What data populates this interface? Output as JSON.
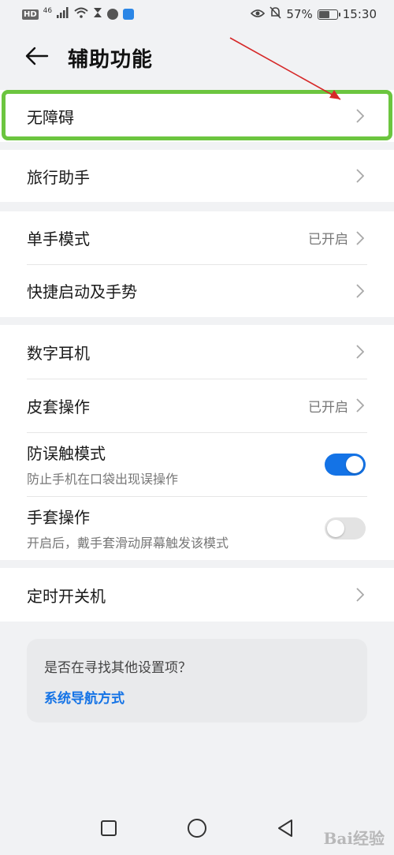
{
  "status_bar": {
    "hd_badge": "HD",
    "network": "46",
    "battery_percent": "57%",
    "time": "15:30",
    "icons": [
      "signal-icon",
      "wifi-icon",
      "hourglass-icon",
      "app-icon",
      "app-icon",
      "eye-icon",
      "bell-off-icon",
      "battery-icon"
    ]
  },
  "header": {
    "title": "辅助功能",
    "back_icon": "arrow-left-icon"
  },
  "groups": [
    {
      "items": [
        {
          "label": "无障碍",
          "value": ""
        }
      ]
    },
    {
      "items": [
        {
          "label": "旅行助手",
          "value": ""
        }
      ]
    },
    {
      "items": [
        {
          "label": "单手模式",
          "value": "已开启"
        },
        {
          "label": "快捷启动及手势",
          "value": ""
        }
      ]
    },
    {
      "items": [
        {
          "label": "数字耳机",
          "value": ""
        },
        {
          "label": "皮套操作",
          "value": "已开启"
        },
        {
          "label": "防误触模式",
          "sub": "防止手机在口袋出现误操作",
          "toggle": true
        },
        {
          "label": "手套操作",
          "sub": "开启后，戴手套滑动屏幕触发该模式",
          "toggle": false
        }
      ]
    },
    {
      "items": [
        {
          "label": "定时开关机",
          "value": ""
        }
      ]
    }
  ],
  "suggestion": {
    "question": "是否在寻找其他设置项？",
    "link": "系统导航方式"
  },
  "nav": {
    "icons": [
      "recents-square-icon",
      "home-circle-icon",
      "back-triangle-icon"
    ]
  },
  "watermark": "Bai经验",
  "colors": {
    "accent": "#1473e6",
    "highlight_border": "#6cc53f",
    "annotation_arrow": "#d62828",
    "background": "#f1f2f4"
  }
}
